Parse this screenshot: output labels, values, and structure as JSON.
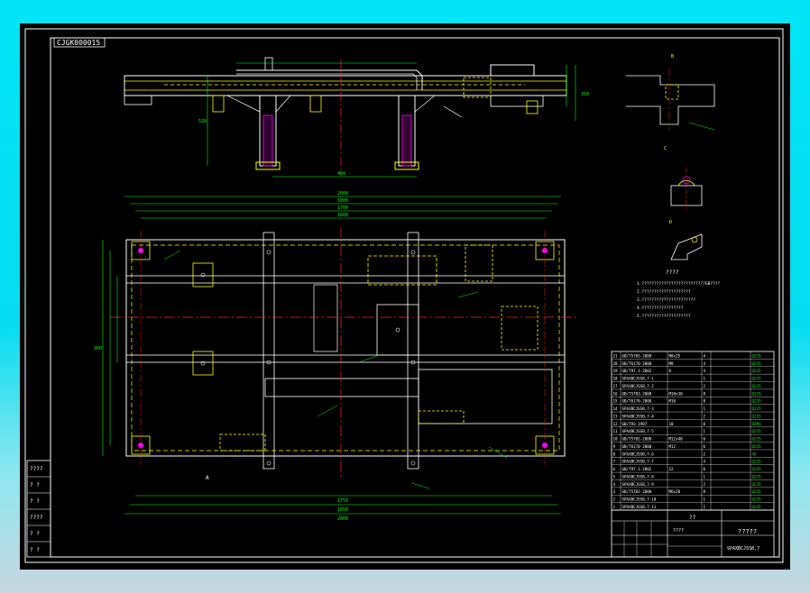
{
  "drawing": {
    "title_tag": "CJGK000015",
    "drawing_number": "SPAXBCJSSB,7",
    "title_name": "?????",
    "company": "????",
    "subtitle_center": "??",
    "section_label_a": "A",
    "section_label_b": "B",
    "section_label_c": "C",
    "section_label_d": "D",
    "notes_title": "????",
    "notes": [
      "1.??????????????????????????GB????",
      "2.????????????????????",
      "3.??????????????????????",
      "4.?????????????????",
      "5.????????????????????"
    ],
    "left_panel_labels": [
      "????",
      "? ?",
      "? ?",
      "????",
      "? ?",
      "? ?"
    ],
    "bom_rows": [
      [
        "21",
        "GB/T5783-2000",
        "M8x25",
        "4",
        "",
        "Q235"
      ],
      [
        "20",
        "GB/T6170-2000",
        "M8",
        "4",
        "",
        "Q235"
      ],
      [
        "19",
        "GB/T97.1-2002",
        "8",
        "4",
        "",
        "Q235"
      ],
      [
        "18",
        "SPAXBCJSSB,7-1",
        "",
        "1",
        "",
        "Q235"
      ],
      [
        "17",
        "SPAXBCJSSB,7-2",
        "",
        "2",
        "",
        "Q235"
      ],
      [
        "16",
        "GB/T5783-2000",
        "M10x30",
        "8",
        "",
        "Q235"
      ],
      [
        "15",
        "GB/T6170-2000",
        "M10",
        "8",
        "",
        "Q235"
      ],
      [
        "14",
        "SPAXBCJSSB,7-3",
        "",
        "1",
        "",
        "Q235"
      ],
      [
        "13",
        "SPAXBCJSSB,7-4",
        "",
        "2",
        "",
        "Q235"
      ],
      [
        "12",
        "GB/T93-1987",
        "10",
        "8",
        "",
        "65Mn"
      ],
      [
        "11",
        "SPAXBCJSSB,7-5",
        "",
        "1",
        "",
        "Q235"
      ],
      [
        "10",
        "GB/T5782-2000",
        "M12x40",
        "6",
        "",
        "Q235"
      ],
      [
        "9",
        "GB/T6170-2000",
        "M12",
        "6",
        "",
        "Q235"
      ],
      [
        "8",
        "SPAXBCJSSB,7-6",
        "",
        "2",
        "",
        "45"
      ],
      [
        "7",
        "SPAXBCJSSB,7-7",
        "",
        "4",
        "",
        "Q235"
      ],
      [
        "6",
        "GB/T97.1-2002",
        "12",
        "6",
        "",
        "Q235"
      ],
      [
        "5",
        "SPAXBCJSSB,7-8",
        "",
        "1",
        "",
        "Q235"
      ],
      [
        "4",
        "SPAXBCJSSB,7-9",
        "",
        "2",
        "",
        "Q235"
      ],
      [
        "3",
        "GB/T5783-2000",
        "M6x20",
        "8",
        "",
        "Q235"
      ],
      [
        "2",
        "SPAXBCJSSB,7-10",
        "",
        "1",
        "",
        "Q235"
      ],
      [
        "1",
        "SPAXBCJSSB,7-11",
        "",
        "1",
        "",
        "Q235"
      ]
    ],
    "dims": {
      "front_width": "1650",
      "plan_total": "2000",
      "plan_inner_1": "1800",
      "plan_inner_2": "1700",
      "plan_inner_3": "1600",
      "plan_bottom_1": "1750",
      "plan_bottom_2": "1850",
      "plan_bottom_3": "2000",
      "plan_height": "900",
      "front_height": "350",
      "leg_height": "520",
      "leg_span": "460"
    },
    "colors": {
      "frame": "#ffffff",
      "border": "#00ff00",
      "geometry": "#ffff00",
      "dimension": "#00ff00",
      "centerline": "#ff2222",
      "hidden": "#ffff00",
      "accent": "#ff00ff",
      "cyan": "#00ffff"
    }
  }
}
